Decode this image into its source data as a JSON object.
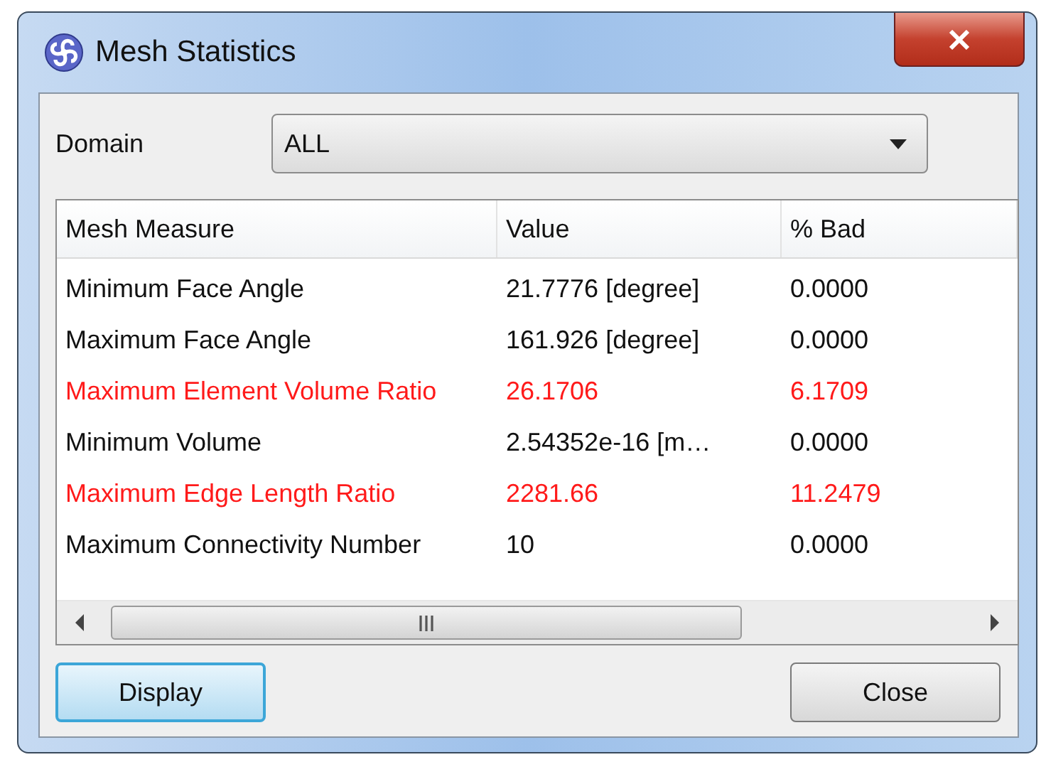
{
  "window": {
    "title": "Mesh Statistics"
  },
  "domain": {
    "label": "Domain",
    "value": "ALL"
  },
  "table": {
    "columns": [
      "Mesh Measure",
      "Value",
      "% Bad"
    ],
    "rows": [
      {
        "cells": [
          "Minimum Face Angle",
          "21.7776 [degree]",
          "0.0000"
        ],
        "flagged": false
      },
      {
        "cells": [
          "Maximum Face Angle",
          "161.926 [degree]",
          "0.0000"
        ],
        "flagged": false
      },
      {
        "cells": [
          "Maximum Element Volume Ratio",
          "26.1706",
          "6.1709"
        ],
        "flagged": true
      },
      {
        "cells": [
          "Minimum Volume",
          "2.54352e-16 [m…",
          "0.0000"
        ],
        "flagged": false
      },
      {
        "cells": [
          "Maximum Edge Length Ratio",
          "2281.66",
          "11.2479"
        ],
        "flagged": true
      },
      {
        "cells": [
          "Maximum Connectivity Number",
          "10",
          "0.0000"
        ],
        "flagged": false
      }
    ]
  },
  "buttons": [
    {
      "label": "Display",
      "focused": true
    },
    {
      "label": "Close",
      "focused": false
    }
  ]
}
